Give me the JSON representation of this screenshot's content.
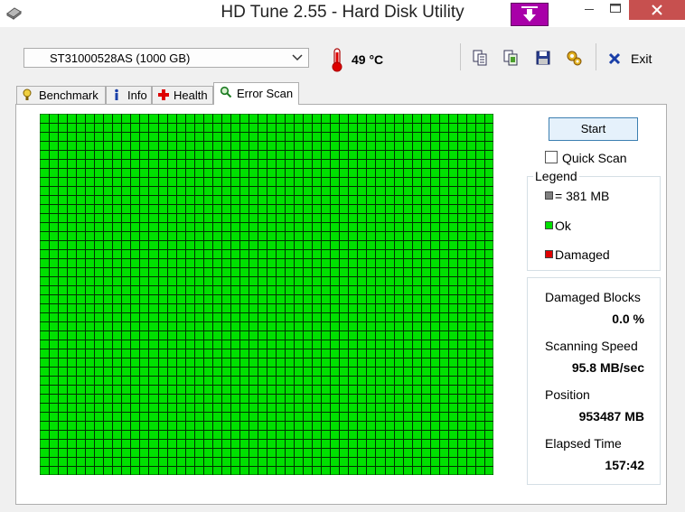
{
  "window": {
    "title": "HD Tune 2.55 - Hard Disk Utility"
  },
  "toolbar": {
    "drive": "ST31000528AS (1000 GB)",
    "temperature": "49 °C",
    "exit_label": "Exit"
  },
  "tabs": [
    {
      "label": "Benchmark",
      "icon": "benchmark-icon"
    },
    {
      "label": "Info",
      "icon": "info-icon"
    },
    {
      "label": "Health",
      "icon": "health-icon"
    },
    {
      "label": "Error Scan",
      "icon": "search-icon",
      "active": true
    }
  ],
  "scan": {
    "start_label": "Start",
    "quick_scan_label": "Quick Scan",
    "quick_scan_checked": false,
    "grid_columns": 50,
    "grid_rows": 40,
    "block_color": "#00e000",
    "grid_line_color": "#003300"
  },
  "legend": {
    "title": "Legend",
    "items": [
      {
        "label": "= 381 MB",
        "color": "#808080"
      },
      {
        "label": "Ok",
        "color": "#00e000"
      },
      {
        "label": "Damaged",
        "color": "#e00000"
      }
    ]
  },
  "stats": {
    "damaged_blocks_label": "Damaged Blocks",
    "damaged_blocks_value": "0.0 %",
    "speed_label": "Scanning Speed",
    "speed_value": "95.8 MB/sec",
    "position_label": "Position",
    "position_value": "953487 MB",
    "elapsed_label": "Elapsed Time",
    "elapsed_value": "157:42"
  }
}
